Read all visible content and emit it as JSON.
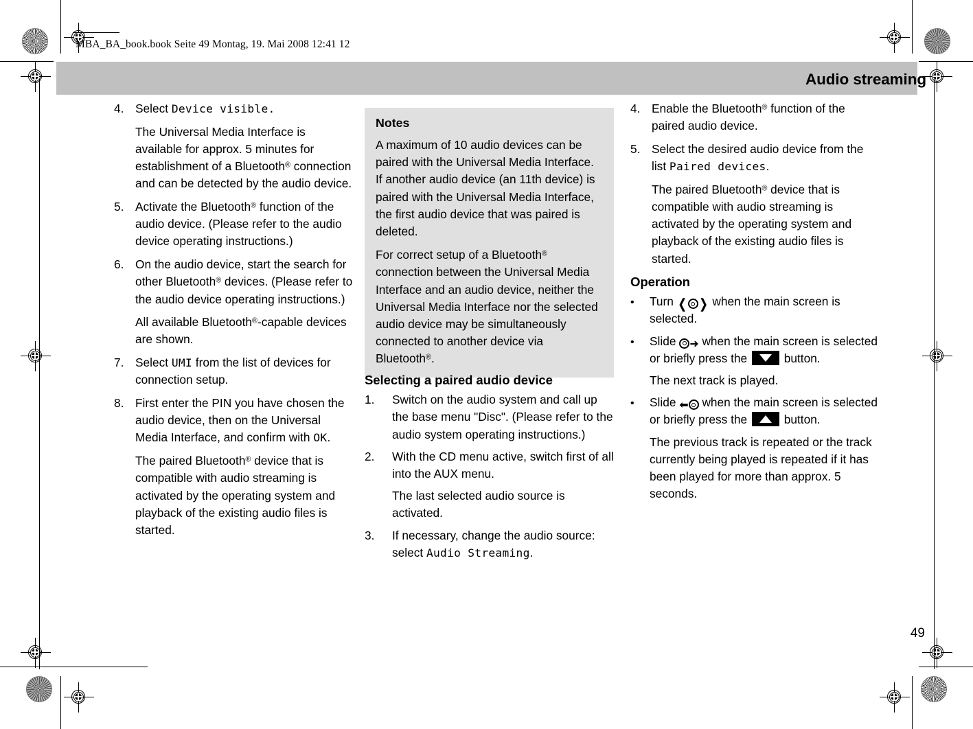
{
  "header": {
    "filestamp": "MBA_BA_book.book  Seite 49  Montag, 19. Mai 2008  12:41 12",
    "title": "Audio streaming",
    "band_color": "#c0c0c0"
  },
  "page_number": "49",
  "column1": {
    "items": [
      {
        "marker": "4.",
        "lead_text": "Select ",
        "lead_ui": "Device visible.",
        "paragraphs": [
          "The Universal Media Interface is available for approx. 5 minutes for establishment of a Bluetooth® connection and can be detected by the audio device."
        ]
      },
      {
        "marker": "5.",
        "text": "Activate the Bluetooth® function of the audio device. (Please refer to the audio device operating instructions.)"
      },
      {
        "marker": "6.",
        "text": "On the audio device, start the search for other Bluetooth® devices. (Please refer to the audio device operating instructions.)",
        "paragraphs": [
          "All available Bluetooth®-capable devices are shown."
        ]
      },
      {
        "marker": "7.",
        "text_before_ui": "Select ",
        "ui": "UMI",
        "text_after_ui": " from the list of devices for connection setup."
      },
      {
        "marker": "8.",
        "text_before_ui": "First enter the PIN you have chosen the audio device, then on the Universal Media Interface, and confirm with ",
        "ui": "OK",
        "text_after_ui": ".",
        "paragraphs": [
          "The paired Bluetooth® device that is compatible with audio streaming is activated by the operating system and playback of the existing audio files is started."
        ]
      }
    ]
  },
  "notes": {
    "title": "Notes",
    "background": "#e0e0e0",
    "paragraphs": [
      "A maximum of 10 audio devices can be paired with the Universal Media Interface. If another audio device (an 11th device) is paired with the Universal Media Interface, the first audio device that was paired is deleted.",
      "For correct setup of a Bluetooth® connection between the Universal Media Interface and an audio device, neither the Universal Media Interface nor the selected audio device may be simultaneously connected to another device via Bluetooth®."
    ]
  },
  "selecting_section": {
    "heading": "Selecting a paired audio device",
    "items": [
      {
        "marker": "1.",
        "text": "Switch on the audio system and call up the base menu \"Disc\". (Please refer to the audio system operating instructions.)"
      },
      {
        "marker": "2.",
        "text": "With the CD menu active, switch first of all into the AUX menu.",
        "paragraphs": [
          "The last selected audio source is activated."
        ]
      },
      {
        "marker": "3.",
        "text_before_ui": "If necessary, change the audio source: select ",
        "ui": "Audio Streaming",
        "text_after_ui": "."
      }
    ]
  },
  "column3": {
    "items": [
      {
        "marker": "4.",
        "text": "Enable the Bluetooth® function of the paired audio device."
      },
      {
        "marker": "5.",
        "text_before_ui": "Select the desired audio device from the list ",
        "ui": "Paired devices",
        "text_after_ui": ".",
        "paragraphs": [
          "The paired Bluetooth® device that is compatible with audio streaming is activated by the operating system and playback of the existing audio files is started."
        ]
      }
    ]
  },
  "operation_section": {
    "heading": "Operation",
    "bullets": [
      {
        "marker": "•",
        "verb": "Turn ",
        "icon": "turn-controller-icon",
        "text_after": " when the main screen is selected."
      },
      {
        "marker": "•",
        "verb": "Slide ",
        "icon": "slide-right-controller-icon",
        "text_after": " when the main screen is selected or briefly press the ",
        "button_icon": "down-arrow-button-icon",
        "text_end": " button.",
        "paragraphs": [
          "The next track is played."
        ]
      },
      {
        "marker": "•",
        "verb": "Slide ",
        "icon": "slide-left-controller-icon",
        "text_after": " when the main screen is selected or briefly press the ",
        "button_icon": "up-arrow-button-icon",
        "text_end": " button.",
        "paragraphs": [
          "The previous track is repeated or the track currently being played is repeated if it has been played for more than approx. 5 seconds."
        ]
      }
    ]
  }
}
